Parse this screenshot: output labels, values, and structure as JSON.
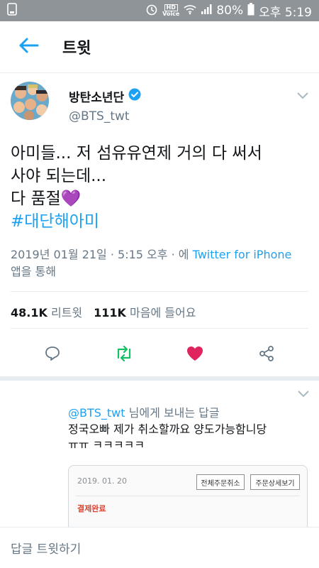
{
  "status_bar": {
    "hd": "HD",
    "voice": "Voice",
    "battery": "80%",
    "time": "오후 5:19"
  },
  "app_bar": {
    "title": "트윗"
  },
  "tweet": {
    "display_name": "방탄소년단",
    "handle": "@BTS_twt",
    "text_line1": "아미들... 저 섬유유연제 거의 다 써서",
    "text_line2": "사야 되는데...",
    "text_line3": "다 품절💜",
    "hashtag": "#대단해아미",
    "timestamp": "2019년 01월 21일 · 5:15 오후 · 에",
    "client": "Twitter for iPhone",
    "client_suffix": "앱을 통해",
    "retweets_count": "48.1K",
    "retweets_label": "리트윗",
    "likes_count": "111K",
    "likes_label": "마음에 들어요"
  },
  "reply": {
    "mention": "@BTS_twt",
    "to_suffix": "님에게 보내는 답글",
    "text_line1": "정국오빠 제가 취소할까요 양도가능함니당",
    "text_line2": "ㅠㅠ ㅋㅋㅋㅋㅋ",
    "card": {
      "date": "2019. 01. 20",
      "cancel_all": "전체주문취소",
      "details": "주문상세보기",
      "status": "결제완료"
    }
  },
  "compose": {
    "placeholder": "답글 트윗하기"
  },
  "colors": {
    "accent": "#1da1f2",
    "retweet": "#17bf63",
    "like": "#e0245e",
    "status_bar": "#8f9499"
  },
  "icons": [
    "back-arrow-icon",
    "verified-badge-icon",
    "chevron-down-icon",
    "reply-icon",
    "retweet-icon",
    "heart-icon",
    "share-icon"
  ]
}
